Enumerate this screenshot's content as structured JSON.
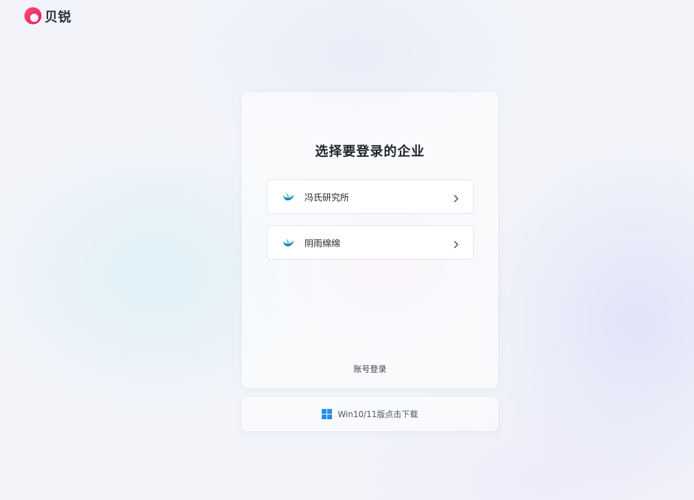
{
  "brand": {
    "name": "贝锐",
    "logo_icon": "beirui-logo-icon",
    "accent_color": "#f0386b"
  },
  "login_card": {
    "title": "选择要登录的企业",
    "organizations": [
      {
        "name": "冯氏研究所",
        "icon": "org-logo-icon"
      },
      {
        "name": "阴雨绵绵",
        "icon": "org-logo-icon"
      }
    ],
    "account_login_label": "账号登录"
  },
  "download": {
    "icon": "windows-icon",
    "label": "Win10/11版点击下载"
  }
}
